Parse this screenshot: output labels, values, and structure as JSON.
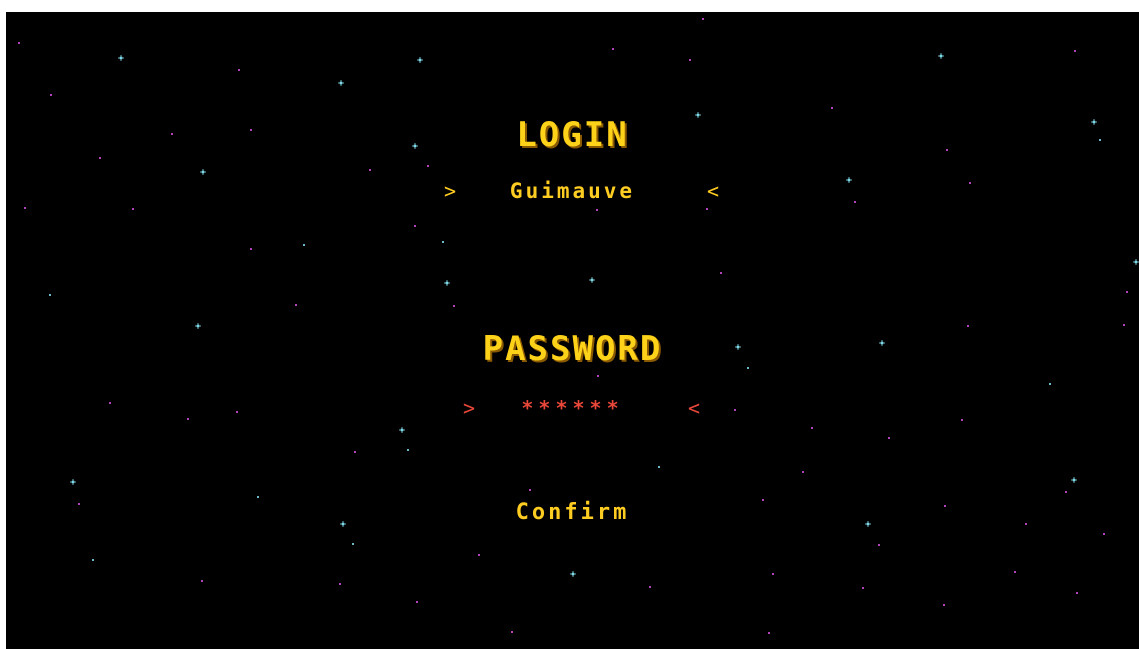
{
  "colors": {
    "background": "#000000",
    "title": "#ffd21a",
    "text": "#ffcc22",
    "password": "#e8473a",
    "star_cyan": "#7fd8e6",
    "star_magenta": "#d04fd8"
  },
  "login": {
    "title": "LOGIN",
    "left_arrow": ">",
    "value": "Guimauve",
    "right_arrow": "<"
  },
  "password": {
    "title": "PASSWORD",
    "left_arrow": ">",
    "value": "******",
    "right_arrow": "<"
  },
  "confirm": {
    "label": "Confirm"
  }
}
